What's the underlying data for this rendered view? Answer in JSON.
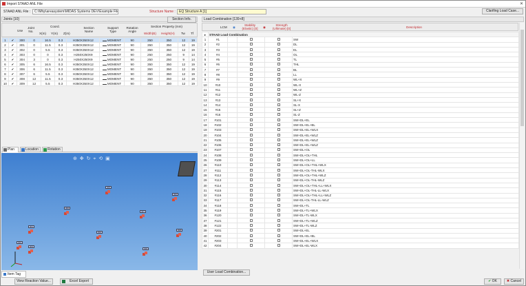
{
  "window": {
    "title": "Import STAAD ANL File",
    "close_glyph": "✕"
  },
  "top": {
    "anl_label": "STAAD ANL File :",
    "anl_path": "C:\\Mhp\\areasystem\\MIDAS Systems DEV\\Example Files\\MEG",
    "structure_label": "Structure Name :",
    "structure_value": "EQ Structure A [1]",
    "clarify_button": "Clarifing Load Case..."
  },
  "joints": {
    "header": "Joints [10]",
    "section_info_button": "Section Info.",
    "columns": {
      "use": "Use",
      "no": "Joint No.",
      "coord": "Coord.",
      "x": "X(m)",
      "y": "Y(m)",
      "z": "Z(m)",
      "section_name": "Section Name",
      "support_type": "Support Type",
      "rotation_angle": "Rotation Angle",
      "section_property": "Section Property (mm)",
      "width": "Width(B)",
      "height": "Height(H)",
      "tw": "Tw",
      "tf": "Tf"
    },
    "rows": [
      {
        "idx": "1",
        "use": "✔",
        "no": "300",
        "x": "0",
        "y": "16.5",
        "z": "0.3",
        "section": "H350X350X12",
        "support": "MOMENT",
        "angle": "90",
        "w": "350",
        "h": "350",
        "tw": "12",
        "tf": "19"
      },
      {
        "idx": "2",
        "use": "✔",
        "no": "301",
        "x": "0",
        "y": "11.5",
        "z": "0.3",
        "section": "H350X350X12",
        "support": "MOMENT",
        "angle": "90",
        "w": "350",
        "h": "350",
        "tw": "12",
        "tf": "19"
      },
      {
        "idx": "3",
        "use": "✔",
        "no": "302",
        "x": "0",
        "y": "5.5",
        "z": "0.3",
        "section": "H350X350X12",
        "support": "MOMENT",
        "angle": "90",
        "w": "350",
        "h": "350",
        "tw": "12",
        "tf": "19"
      },
      {
        "idx": "4",
        "use": "✔",
        "no": "303",
        "x": "0",
        "y": "0",
        "z": "0.3",
        "section": "H250X250X9",
        "support": "MOMENT",
        "angle": "90",
        "w": "250",
        "h": "250",
        "tw": "9",
        "tf": "14"
      },
      {
        "idx": "5",
        "use": "✔",
        "no": "304",
        "x": "3",
        "y": "0",
        "z": "0.3",
        "section": "H250X250X9",
        "support": "MOMENT",
        "angle": "90",
        "w": "250",
        "h": "250",
        "tw": "9",
        "tf": "14"
      },
      {
        "idx": "6",
        "use": "✔",
        "no": "305",
        "x": "6",
        "y": "16.5",
        "z": "0.3",
        "section": "H350X350X12",
        "support": "MOMENT",
        "angle": "90",
        "w": "350",
        "h": "350",
        "tw": "12",
        "tf": "19"
      },
      {
        "idx": "7",
        "use": "✔",
        "no": "306",
        "x": "6",
        "y": "11.5",
        "z": "0.3",
        "section": "H350X350X12",
        "support": "MOMENT",
        "angle": "90",
        "w": "350",
        "h": "350",
        "tw": "12",
        "tf": "19"
      },
      {
        "idx": "8",
        "use": "✔",
        "no": "307",
        "x": "6",
        "y": "5.5",
        "z": "0.3",
        "section": "H350X350X12",
        "support": "MOMENT",
        "angle": "90",
        "w": "350",
        "h": "350",
        "tw": "12",
        "tf": "19"
      },
      {
        "idx": "9",
        "use": "✔",
        "no": "308",
        "x": "12",
        "y": "11.5",
        "z": "0.3",
        "section": "H350X350X12",
        "support": "MOMENT",
        "angle": "90",
        "w": "350",
        "h": "350",
        "tw": "12",
        "tf": "19"
      },
      {
        "idx": "10",
        "use": "✔",
        "no": "309",
        "x": "12",
        "y": "5.5",
        "z": "0.3",
        "section": "H350X350X12",
        "support": "MOMENT",
        "angle": "90",
        "w": "350",
        "h": "350",
        "tw": "12",
        "tf": "19"
      }
    ]
  },
  "view_tabs": [
    {
      "label": "Plan"
    },
    {
      "label": "Location"
    },
    {
      "label": "Rotation"
    }
  ],
  "view": {
    "node_labels": [
      "305",
      "306",
      "300",
      "307",
      "301",
      "308",
      "302",
      "309",
      "303",
      "304"
    ],
    "toolbar_glyphs": "⊕ ✥ ↻ ⌖ ⟲ ▣",
    "item_tag": "Item Tag"
  },
  "load": {
    "header": "Load Combination [139+8]",
    "columns": {
      "lcm": "LCM",
      "stability": "Stability (Elastic) [0]",
      "strength": "Strength (Ultimate) [0]",
      "description": "Description"
    },
    "group_title": "STAAD Load Combination",
    "rows": [
      [
        "1",
        "#1",
        "SW"
      ],
      [
        "2",
        "#2",
        "DL"
      ],
      [
        "3",
        "#3",
        "EL"
      ],
      [
        "4",
        "#4",
        "OL"
      ],
      [
        "5",
        "#5",
        "TL"
      ],
      [
        "6",
        "#6",
        "THL"
      ],
      [
        "7",
        "#7",
        "BL"
      ],
      [
        "8",
        "#8",
        "LL"
      ],
      [
        "9",
        "#9",
        "WL+X"
      ],
      [
        "10",
        "#10",
        "WL-X"
      ],
      [
        "11",
        "#11",
        "WL+Z"
      ],
      [
        "12",
        "#12",
        "WL-Z"
      ],
      [
        "13",
        "#13",
        "SL+X"
      ],
      [
        "14",
        "#14",
        "SL-X"
      ],
      [
        "15",
        "#15",
        "SL+Z"
      ],
      [
        "16",
        "#16",
        "SL-Z"
      ],
      [
        "17",
        "#101",
        "SW+DL+EL"
      ],
      [
        "18",
        "#102",
        "SW+DL+EL+BL"
      ],
      [
        "19",
        "#103",
        "SW+DL+EL+WLX"
      ],
      [
        "20",
        "#104",
        "SW+DL+EL+WLZ"
      ],
      [
        "21",
        "#105",
        "SW+DL+EL+WLZ"
      ],
      [
        "22",
        "#106",
        "SW+DL+EL+WLZ"
      ],
      [
        "23",
        "#107",
        "SW+DL+OL"
      ],
      [
        "24",
        "#108",
        "SW+DL+OL+THL"
      ],
      [
        "25",
        "#109",
        "SW+DL+OL+LL"
      ],
      [
        "26",
        "#110",
        "SW+DL+OL+THL+WLX"
      ],
      [
        "27",
        "#111",
        "SW+DL+OL-THL-WLX"
      ],
      [
        "28",
        "#112",
        "SW+DL+OL+THL+WLZ"
      ],
      [
        "29",
        "#113",
        "SW+DL+OL-THL-WLZ"
      ],
      [
        "30",
        "#114",
        "SW+DL+OL+THL+LL+WLX"
      ],
      [
        "31",
        "#115",
        "SW+DL+OL-THL-LL-WLX"
      ],
      [
        "32",
        "#116",
        "SW+DL+OL+THL+LL+WLZ"
      ],
      [
        "33",
        "#117",
        "SW+DL+OL-THL-LL-WLZ"
      ],
      [
        "34",
        "#118",
        "SW+DL+TL"
      ],
      [
        "35",
        "#119",
        "SW+DL+TL+WLX"
      ],
      [
        "36",
        "#120",
        "SW+DL+TL-WLX"
      ],
      [
        "37",
        "#121",
        "SW+DL+TL+WLZ"
      ],
      [
        "38",
        "#122",
        "SW+DL+TL-WLZ"
      ],
      [
        "39",
        "#201",
        "SW+DL+EL"
      ],
      [
        "40",
        "#202",
        "SW+DL+EL+BL"
      ],
      [
        "41",
        "#203",
        "SW+DL+EL+WLX"
      ],
      [
        "42",
        "#204",
        "SW+DL+EL-WLX"
      ]
    ],
    "user_button": "User Load Combination..."
  },
  "bottom": {
    "view_reaction": "View Reaction Value...",
    "excel_export": "Excel Export",
    "ok": "OK",
    "cancel": "Cancel"
  },
  "colors": {
    "accent_red": "#c0282d",
    "selection": "#cfe2f7",
    "view_top": "#3e7fd0",
    "view_bottom": "#8ab8e8",
    "node": "#d24a3a"
  }
}
